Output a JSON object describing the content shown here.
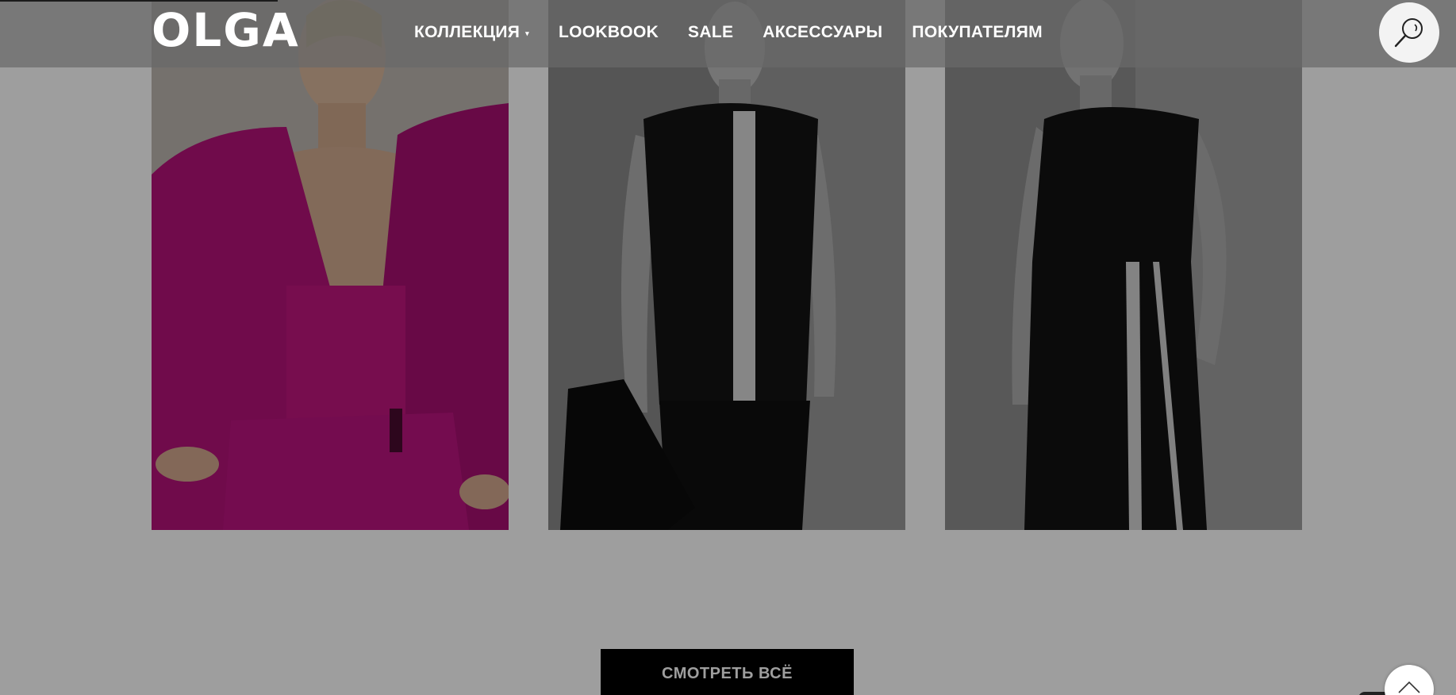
{
  "header": {
    "logo_text": "OLGA",
    "nav": [
      {
        "label": "КОЛЛЕКЦИЯ",
        "has_dropdown": true
      },
      {
        "label": "LOOKBOOK",
        "has_dropdown": false
      },
      {
        "label": "SALE",
        "has_dropdown": false
      },
      {
        "label": "АКСЕССУАРЫ",
        "has_dropdown": false
      },
      {
        "label": "ПОКУПАТЕЛЯМ",
        "has_dropdown": false
      }
    ],
    "dropdown_caret": "▾",
    "search_icon": "search-icon"
  },
  "products": [
    {
      "image": "pink-suit-photo",
      "garment_color": "#c0157f"
    },
    {
      "image": "black-top-white-stripe-photo",
      "garment_color": "#141414"
    },
    {
      "image": "black-dress-white-stripe-photo",
      "garment_color": "#121212"
    }
  ],
  "view_all_label": "СМОТРЕТЬ ВСЁ",
  "scroll_top_icon": "chevron-up-icon",
  "colors": {
    "header_bg": "#696969",
    "button_bg": "#000000",
    "accent_pink": "#c0157f"
  }
}
